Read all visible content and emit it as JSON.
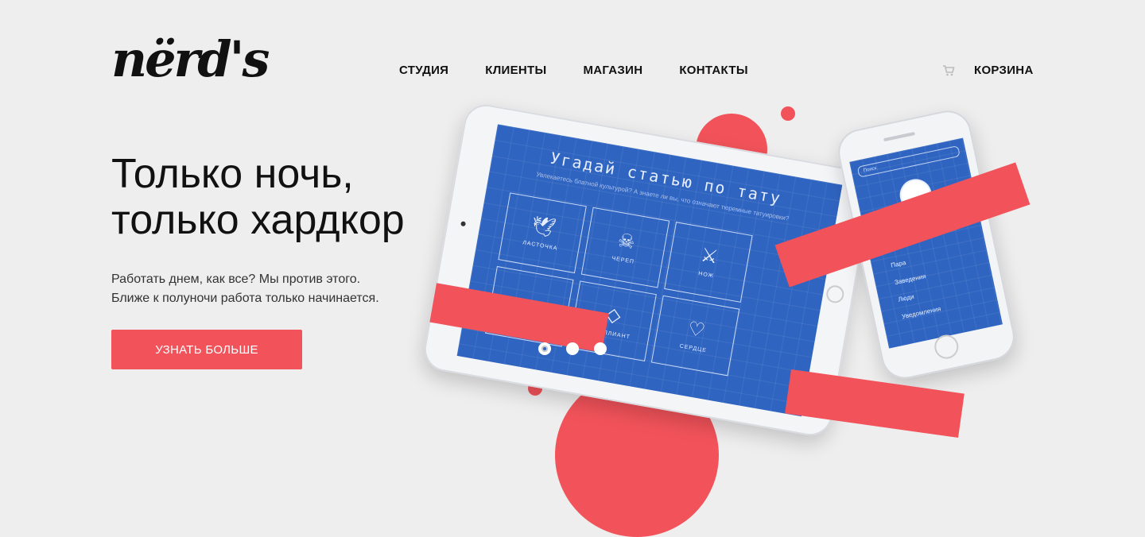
{
  "brand": {
    "logo_text": "nërd's"
  },
  "nav": {
    "items": [
      "СТУДИЯ",
      "КЛИЕНТЫ",
      "МАГАЗИН",
      "КОНТАКТЫ"
    ]
  },
  "cart": {
    "label": "КОРЗИНА",
    "icon": "cart-icon"
  },
  "hero": {
    "headline_line1": "Только ночь,",
    "headline_line2": "только хардкор",
    "lead_line1": "Работать днем, как все? Мы против этого.",
    "lead_line2": "Ближе к полуночи работа только начинается.",
    "cta_label": "УЗНАТЬ БОЛЬШЕ"
  },
  "tablet_screen": {
    "title": "Угадай статью по тату",
    "subtitle": "Увлекаетесь блатной культурой? А знаете ли вы, что означают тюремные татуировки?",
    "tiles": [
      "ЛАСТОЧКА",
      "ЧЕРЕП",
      "НОЖ",
      "",
      "БРИЛЛИАНТ",
      "СЕРДЦЕ"
    ]
  },
  "phone_screen": {
    "search_placeholder": "Поиск",
    "menu": [
      "Пара",
      "Заведения",
      "Люди",
      "Уведомления"
    ]
  },
  "slider": {
    "count": 3,
    "active_index": 0
  },
  "colors": {
    "accent": "#f2535a",
    "background": "#eeeeee",
    "screen_blue": "#2f64c0"
  }
}
